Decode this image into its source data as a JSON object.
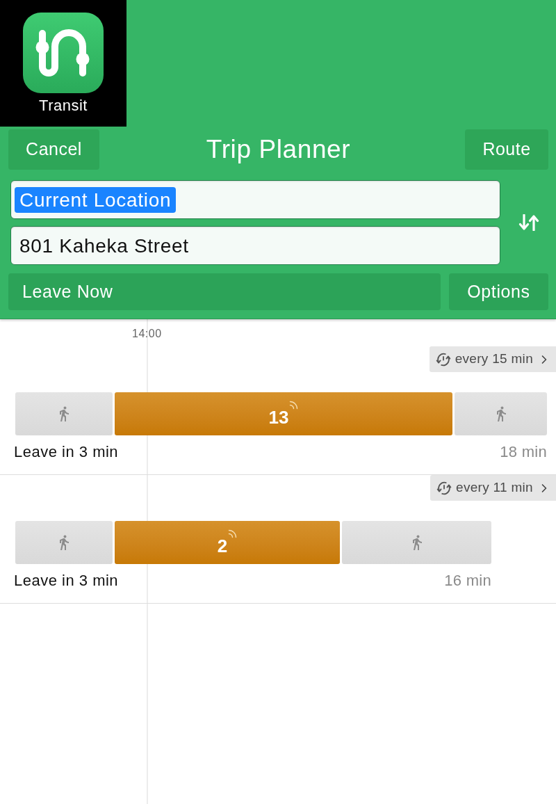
{
  "app_icon": {
    "label": "Transit"
  },
  "nav": {
    "cancel": "Cancel",
    "title": "Trip Planner",
    "route": "Route"
  },
  "origin": {
    "value": "Current Location",
    "highlighted": true
  },
  "destination": {
    "value": "801 Kaheka Street",
    "highlighted": false
  },
  "time_button": "Leave Now",
  "options_button": "Options",
  "timeline": {
    "time_label": "14:00"
  },
  "trips": [
    {
      "frequency": "every 15 min",
      "segments": [
        {
          "kind": "walk"
        },
        {
          "kind": "bus",
          "route": "13",
          "realtime": true
        },
        {
          "kind": "walk"
        }
      ],
      "departure": "Leave in 3 min",
      "duration": "18 min"
    },
    {
      "frequency": "every 11 min",
      "segments": [
        {
          "kind": "walk"
        },
        {
          "kind": "bus",
          "route": "2",
          "realtime": true
        },
        {
          "kind": "walk"
        }
      ],
      "departure": "Leave in 3 min",
      "duration": "16 min"
    }
  ]
}
